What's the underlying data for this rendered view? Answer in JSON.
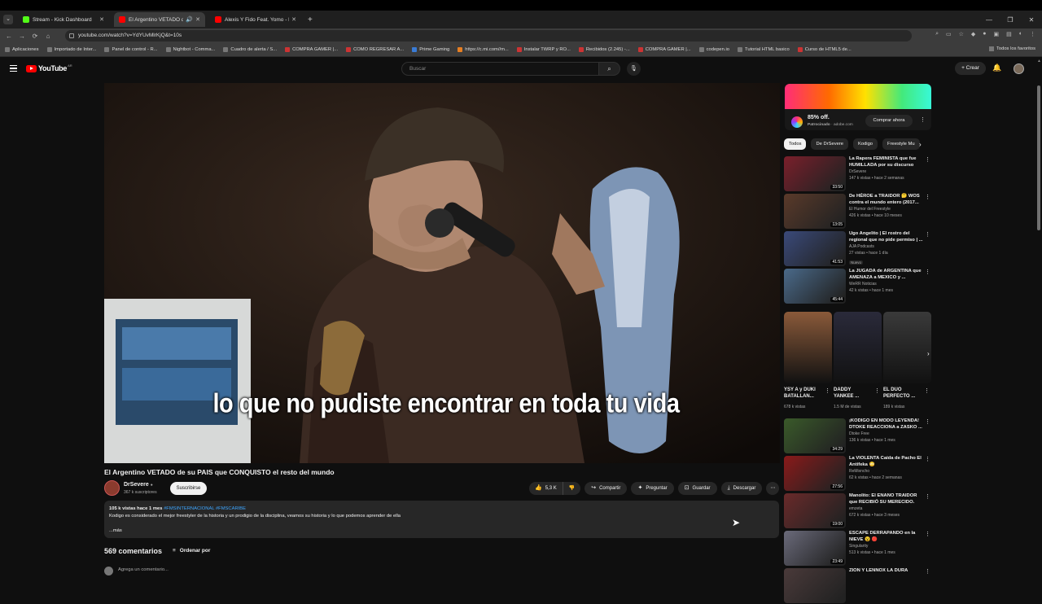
{
  "browser": {
    "tabs": [
      {
        "label": "Stream - Kick Dashboard",
        "favicon": "kick"
      },
      {
        "label": "El Argentino VETADO de su",
        "favicon": "youtube",
        "active": true
      },
      {
        "label": "Alexis Y Fido Feat. Yomo - Bella",
        "favicon": "youtube"
      }
    ],
    "url": "youtube.com/watch?v=YdYUvMlrKjQ&t=10s",
    "bookmarks": [
      "Aplicaciones",
      "Importado de Inter...",
      "Panel de control - R...",
      "Nightbot - Comma...",
      "Cuadro de alerta / S...",
      "COMPRA GAMER |...",
      "COMO REGRESAR A...",
      "Prime Gaming",
      "https://c.mi.com//m...",
      "Instalar TWRP y RO...",
      "Recibidos (2.245) -...",
      "COMPRA GAMER |...",
      "codepen.io",
      "Tutorial HTML basico",
      "Curso de HTML5 de..."
    ],
    "bookmarks_right": "Todos los favoritos"
  },
  "youtube": {
    "logo": "YouTube",
    "country": "AR",
    "search_placeholder": "Buscar",
    "create_label": "Crear"
  },
  "video": {
    "subtitle": "lo que no pudiste encontrar en toda tu vida",
    "title": "El Argentino VETADO de su PAIS que CONQUISTO el resto del mundo",
    "channel": "DrSevere",
    "subscribers": "367 k suscriptores",
    "subscribe_label": "Suscribirse",
    "likes": "5,3 K",
    "share_label": "Compartir",
    "ask_label": "Preguntar",
    "save_label": "Guardar",
    "download_label": "Descargar",
    "stats": "105 k vistas  hace 1 mes",
    "hashtags": "#FMSINTERNACIONAL #FMSCARIBE",
    "description": "Kodigo es considerado el mejor freestyler de la historia y un prodigio de la disciplina, veamos su historia y lo que podemos aprender de ella",
    "more_label": "...más"
  },
  "comments": {
    "count": "569 comentarios",
    "sort_label": "Ordenar por",
    "placeholder": "Agrega un comentario..."
  },
  "ad": {
    "offer": "85% off.",
    "sponsored": "Patrocinado",
    "domain": "adobe.com",
    "cta": "Comprar ahora"
  },
  "chips": [
    "Todos",
    "De DrSevere",
    "Kodigo",
    "Freestyle Mu"
  ],
  "recommended_top": [
    {
      "title": "La Rapera FEMINISTA que fue HUMILLADA por su discurso",
      "channel": "DrSevere",
      "meta": "147 k vistas • hace 2 semanas",
      "duration": "33:50",
      "thumb": "#7a1f2b"
    },
    {
      "title": "De HÉROE a TRAIDOR 🤔 WOS contra el mundo entero (2017...",
      "channel": "El Humor del Freestyle",
      "meta": "426 k vistas • hace 10 meses",
      "duration": "13:05",
      "thumb": "#5a3a2a"
    },
    {
      "title": "Ugo Angelito | El rostro del regional que no pide permiso | ...",
      "channel": "AJA Podcasts",
      "meta": "27 vistas • hace 1 día",
      "duration": "41:53",
      "thumb": "#3a4a7a",
      "badge": "Nuevo"
    },
    {
      "title": "La JUGADA de ARGENTINA que AMENAZA a MEXICO y ...",
      "channel": "WeRR Noticias",
      "meta": "42 k vistas • hace 1 mes",
      "duration": "45:44",
      "thumb": "#4a6a8a"
    }
  ],
  "shorts": [
    {
      "title": "YSY A y DUKI BATALLAN...",
      "views": "678 k vistas",
      "thumb": "#8a5a3a"
    },
    {
      "title": "DADDY YANKEE ...",
      "views": "1.5 M de vistas",
      "thumb": "#2a2a3a"
    },
    {
      "title": "EL DUO PERFECTO ...",
      "views": "189 k vistas",
      "thumb": "#3a3a3a"
    }
  ],
  "recommended_bottom": [
    {
      "title": "¡KODIGO EN MODO LEYENDA! DTOKE REACCIONA a ZASKO ...",
      "channel": "Dtoke Free",
      "meta": "136 k vistas • hace 1 mes",
      "duration": "34:29",
      "thumb": "#3a5a2a"
    },
    {
      "title": "La VIOLENTA Caída de Pacho El Antifeka 😳",
      "channel": "ReMixncho",
      "meta": "62 k vistas • hace 2 semanas",
      "duration": "27:56",
      "thumb": "#8a1a1a"
    },
    {
      "title": "Manolito: El ENANO TRAIDOR que RECIBIÓ SU MERECIDO.",
      "channel": "emzeta",
      "meta": "672 k vistas • hace 3 meses",
      "duration": "19:00",
      "thumb": "#6a2a2a"
    },
    {
      "title": "ESCAPE DERRAPANDO en la NIEVE 😮 🔴",
      "channel": "Singularity",
      "meta": "513 k vistas • hace 1 mes",
      "duration": "23:49",
      "thumb": "#6a6a7a"
    },
    {
      "title": "ZION Y LENNOX LA DURA",
      "channel": "",
      "meta": "",
      "duration": "",
      "thumb": "#4a3a3a"
    }
  ]
}
